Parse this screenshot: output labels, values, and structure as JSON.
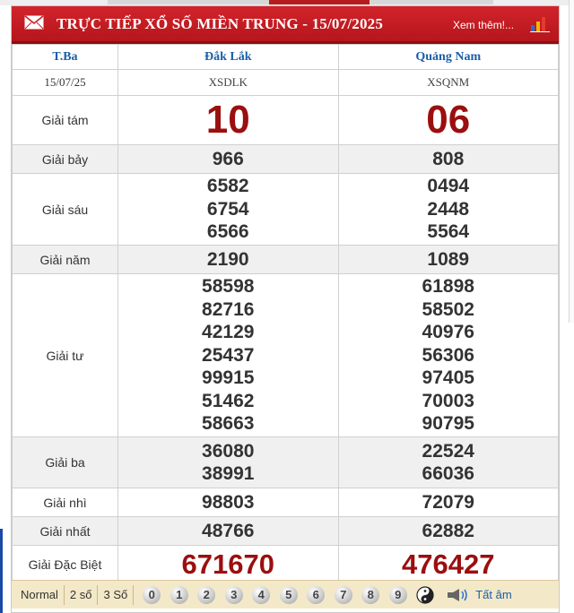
{
  "header": {
    "title": "TRỰC TIẾP XỔ SỐ MIỀN TRUNG - 15/07/2025",
    "more": "Xem thêm!..."
  },
  "table": {
    "day": "T.Ba",
    "date": "15/07/25",
    "provinces": [
      {
        "name": "Đắk Lắk",
        "code": "XSDLK"
      },
      {
        "name": "Quảng Nam",
        "code": "XSQNM"
      }
    ],
    "prizes": [
      {
        "label": "Giải tám",
        "style": "big",
        "values": [
          [
            "10"
          ],
          [
            "06"
          ]
        ]
      },
      {
        "label": "Giải bảy",
        "style": "num",
        "values": [
          [
            "966"
          ],
          [
            "808"
          ]
        ]
      },
      {
        "label": "Giải sáu",
        "style": "num",
        "values": [
          [
            "6582",
            "6754",
            "6566"
          ],
          [
            "0494",
            "2448",
            "5564"
          ]
        ]
      },
      {
        "label": "Giải năm",
        "style": "num",
        "values": [
          [
            "2190"
          ],
          [
            "1089"
          ]
        ]
      },
      {
        "label": "Giải tư",
        "style": "num",
        "values": [
          [
            "58598",
            "82716",
            "42129",
            "25437",
            "99915",
            "51462",
            "58663"
          ],
          [
            "61898",
            "58502",
            "40976",
            "56306",
            "97405",
            "70003",
            "90795"
          ]
        ]
      },
      {
        "label": "Giải ba",
        "style": "num",
        "values": [
          [
            "36080",
            "38991"
          ],
          [
            "22524",
            "66036"
          ]
        ]
      },
      {
        "label": "Giải nhì",
        "style": "num",
        "values": [
          [
            "98803"
          ],
          [
            "72079"
          ]
        ]
      },
      {
        "label": "Giải nhất",
        "style": "num",
        "values": [
          [
            "48766"
          ],
          [
            "62882"
          ]
        ]
      },
      {
        "label": "Giải Đặc Biệt",
        "style": "spec",
        "values": [
          [
            "671670"
          ],
          [
            "476427"
          ]
        ]
      }
    ]
  },
  "toolbar": {
    "modes": [
      "Normal",
      "2 số",
      "3 Số"
    ],
    "digits": [
      "0",
      "1",
      "2",
      "3",
      "4",
      "5",
      "6",
      "7",
      "8",
      "9"
    ],
    "all_label": "Tất âm"
  },
  "colors": {
    "header_red": "#c81e24",
    "prize_red": "#9b0f0f",
    "link_blue": "#1a5ea8",
    "toolbar_bg": "#f3e9c8"
  }
}
